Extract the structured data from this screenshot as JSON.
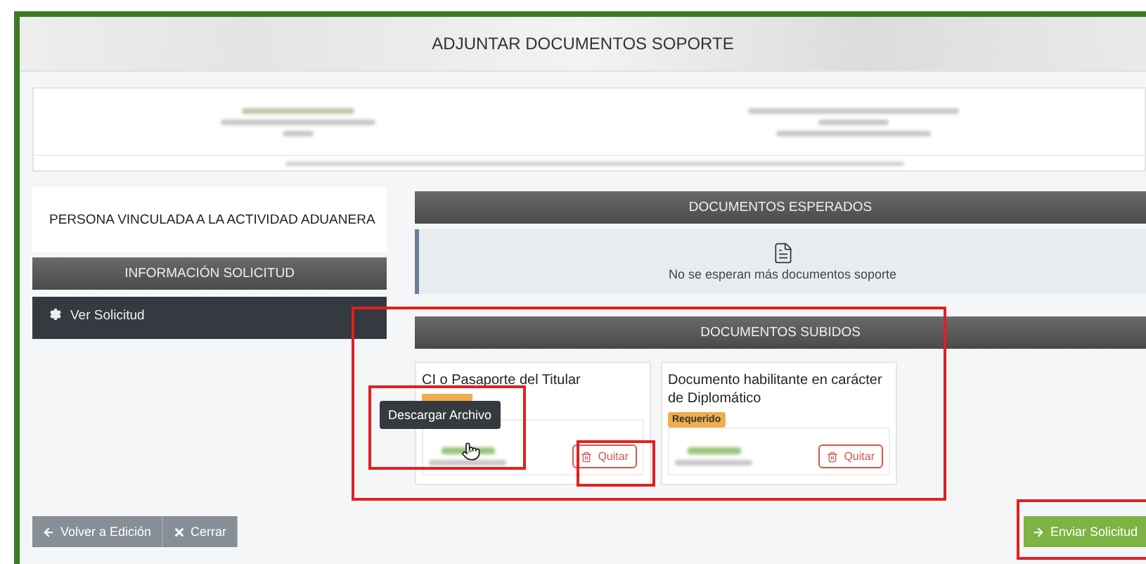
{
  "window": {
    "title": "ADJUNTAR DOCUMENTOS SOPORTE"
  },
  "sidebar": {
    "person_type": "PERSONA VINCULADA A LA ACTIVIDAD ADUANERA",
    "section_header": "INFORMACIÓN SOLICITUD",
    "items": [
      {
        "label": "Ver Solicitud"
      }
    ]
  },
  "expected_documents": {
    "header": "DOCUMENTOS ESPERADOS",
    "empty_message": "No se esperan más documentos soporte"
  },
  "uploaded_documents": {
    "header": "DOCUMENTOS SUBIDOS",
    "items": [
      {
        "title": "CI o Pasaporte del Titular",
        "badge_hidden": true,
        "remove_label": "Quitar",
        "tooltip": "Descargar Archivo"
      },
      {
        "title": "Documento habilitante en carácter de Diplomático",
        "badge": "Requerido",
        "remove_label": "Quitar"
      }
    ]
  },
  "footer": {
    "back_button": "Volver a Edición",
    "close_button": "Cerrar",
    "submit_button": "Enviar Solicitud"
  }
}
